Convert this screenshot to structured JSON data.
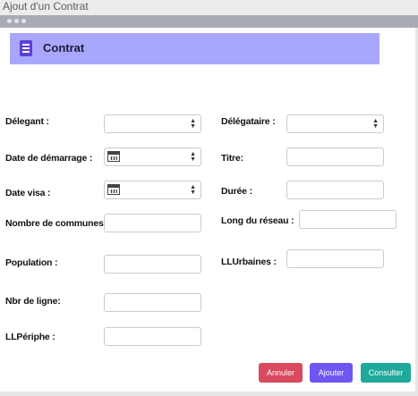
{
  "window": {
    "title": "Ajout d'un Contrat"
  },
  "header": {
    "title": "Contrat",
    "icon": "document-icon"
  },
  "form": {
    "delegant": {
      "label": "Délegant :",
      "value": ""
    },
    "delegataire": {
      "label": "Délégataire :",
      "value": ""
    },
    "date_demarrage": {
      "label": "Date de démarrage :",
      "value": ""
    },
    "titre": {
      "label": "Titre:",
      "value": ""
    },
    "date_visa": {
      "label": "Date visa :",
      "value": ""
    },
    "duree": {
      "label": "Durée :",
      "value": ""
    },
    "nombre_communes": {
      "label": "Nombre de communes:",
      "value": ""
    },
    "long_reseau": {
      "label": "Long du réseau :",
      "value": ""
    },
    "population": {
      "label": "Population :",
      "value": ""
    },
    "llurbaines": {
      "label": "LLUrbaines :",
      "value": ""
    },
    "nbr_ligne": {
      "label": "Nbr de ligne:",
      "value": ""
    },
    "llperiphe": {
      "label": "LLPériphe :",
      "value": ""
    }
  },
  "actions": {
    "annuler": {
      "label": "Annuler",
      "color": "#d94a5e"
    },
    "ajouter": {
      "label": "Ajouter",
      "color": "#6f55f2"
    },
    "consulter": {
      "label": "Consulter",
      "color": "#1ea99a"
    }
  }
}
